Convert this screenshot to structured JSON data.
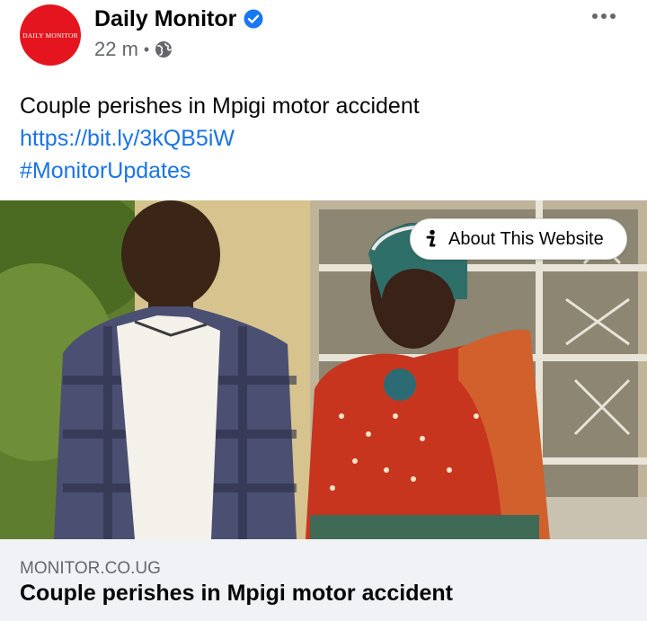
{
  "post": {
    "page_name": "Daily Monitor",
    "avatar_text": "DAILY MONITOR",
    "timestamp": "22 m",
    "separator": "•",
    "privacy_icon": "globe-icon",
    "verified_icon": "verified-badge-icon",
    "more_icon": "more-options-icon",
    "text_line": "Couple perishes in Mpigi motor accident",
    "url": "https://bit.ly/3kQB5iW",
    "hashtag": "#MonitorUpdates"
  },
  "media": {
    "about_label": "About This Website",
    "about_icon": "info-icon"
  },
  "link_card": {
    "domain": "MONITOR.CO.UG",
    "title": "Couple perishes in Mpigi motor accident"
  },
  "colors": {
    "brand_red": "#e4151e",
    "link_blue": "#1b74e4",
    "verified_blue": "#1877f2",
    "meta_gray": "#65676b",
    "card_bg": "#f0f2f5"
  }
}
